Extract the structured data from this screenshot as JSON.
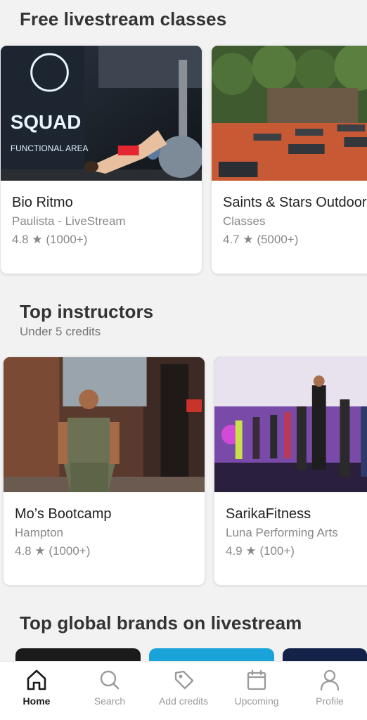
{
  "sections": {
    "livestream": {
      "title": "Free livestream classes"
    },
    "instructors": {
      "title": "Top instructors",
      "subtitle": "Under 5 credits"
    },
    "brands": {
      "title": "Top global brands on livestream"
    }
  },
  "livestream_cards": [
    {
      "name": "Bio Ritmo",
      "subtitle": "Paulista - LiveStream",
      "rating": "4.8 ★ (1000+)"
    },
    {
      "name": "Saints & Stars Outdoor",
      "subtitle": "Classes",
      "rating": "4.7 ★ (5000+)"
    }
  ],
  "instructor_cards": [
    {
      "name": "Mo’s Bootcamp",
      "subtitle": "Hampton",
      "rating": "4.8 ★ (1000+)"
    },
    {
      "name": "SarikaFitness",
      "subtitle": "Luna Performing Arts",
      "rating": "4.9 ★ (100+)"
    }
  ],
  "gym_sign": {
    "line1": "SQUAD",
    "line2": "FUNCTIONAL AREA"
  },
  "tabbar": {
    "tabs": [
      {
        "label": "Home",
        "icon": "home-icon",
        "active": true
      },
      {
        "label": "Search",
        "icon": "search-icon",
        "active": false
      },
      {
        "label": "Add credits",
        "icon": "tag-icon",
        "active": false
      },
      {
        "label": "Upcoming",
        "icon": "calendar-icon",
        "active": false
      },
      {
        "label": "Profile",
        "icon": "person-icon",
        "active": false
      }
    ]
  },
  "colors": {
    "background": "#f2f2f2",
    "card": "#ffffff",
    "active_tab": "#1a1a1a",
    "inactive_tab": "#9a9a9a",
    "brand_tile_1": "#1b1b1b",
    "brand_tile_2": "#1aa3d9",
    "brand_tile_3": "#14224a"
  }
}
